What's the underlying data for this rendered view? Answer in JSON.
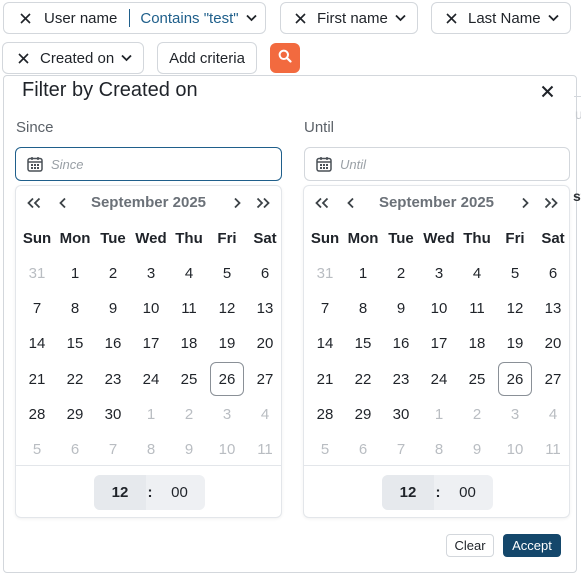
{
  "filters": [
    {
      "name": "User name",
      "operator_value": "Contains \"test\""
    },
    {
      "name": "First name"
    },
    {
      "name": "Last Name"
    },
    {
      "name": "Created on"
    }
  ],
  "add_criteria_label": "Add criteria",
  "ghost": {
    "t1": "u",
    "t2": "st"
  },
  "panel": {
    "title": "Filter by Created on",
    "since": {
      "label": "Since",
      "placeholder": "Since"
    },
    "until": {
      "label": "Until",
      "placeholder": "Until"
    },
    "clear_label": "Clear",
    "accept_label": "Accept"
  },
  "calendar": {
    "month_label": "September 2025",
    "weekdays": [
      "Sun",
      "Mon",
      "Tue",
      "Wed",
      "Thu",
      "Fri",
      "Sat"
    ],
    "days": [
      {
        "d": "31",
        "m": true
      },
      {
        "d": "1"
      },
      {
        "d": "2"
      },
      {
        "d": "3"
      },
      {
        "d": "4"
      },
      {
        "d": "5"
      },
      {
        "d": "6"
      },
      {
        "d": "7"
      },
      {
        "d": "8"
      },
      {
        "d": "9"
      },
      {
        "d": "10"
      },
      {
        "d": "11"
      },
      {
        "d": "12"
      },
      {
        "d": "13"
      },
      {
        "d": "14"
      },
      {
        "d": "15"
      },
      {
        "d": "16"
      },
      {
        "d": "17"
      },
      {
        "d": "18"
      },
      {
        "d": "19"
      },
      {
        "d": "20"
      },
      {
        "d": "21"
      },
      {
        "d": "22"
      },
      {
        "d": "23"
      },
      {
        "d": "24"
      },
      {
        "d": "25"
      },
      {
        "d": "26",
        "today": true
      },
      {
        "d": "27"
      },
      {
        "d": "28"
      },
      {
        "d": "29"
      },
      {
        "d": "30"
      },
      {
        "d": "1",
        "m": true
      },
      {
        "d": "2",
        "m": true
      },
      {
        "d": "3",
        "m": true
      },
      {
        "d": "4",
        "m": true
      },
      {
        "d": "5",
        "m": true
      },
      {
        "d": "6",
        "m": true
      },
      {
        "d": "7",
        "m": true
      },
      {
        "d": "8",
        "m": true
      },
      {
        "d": "9",
        "m": true
      },
      {
        "d": "10",
        "m": true
      },
      {
        "d": "11",
        "m": true
      }
    ],
    "time": {
      "hour": "12",
      "sep": ":",
      "minute": "00"
    }
  },
  "colors": {
    "accent": "#14476b",
    "search": "#f26a3f",
    "link": "#1f5f8b"
  }
}
